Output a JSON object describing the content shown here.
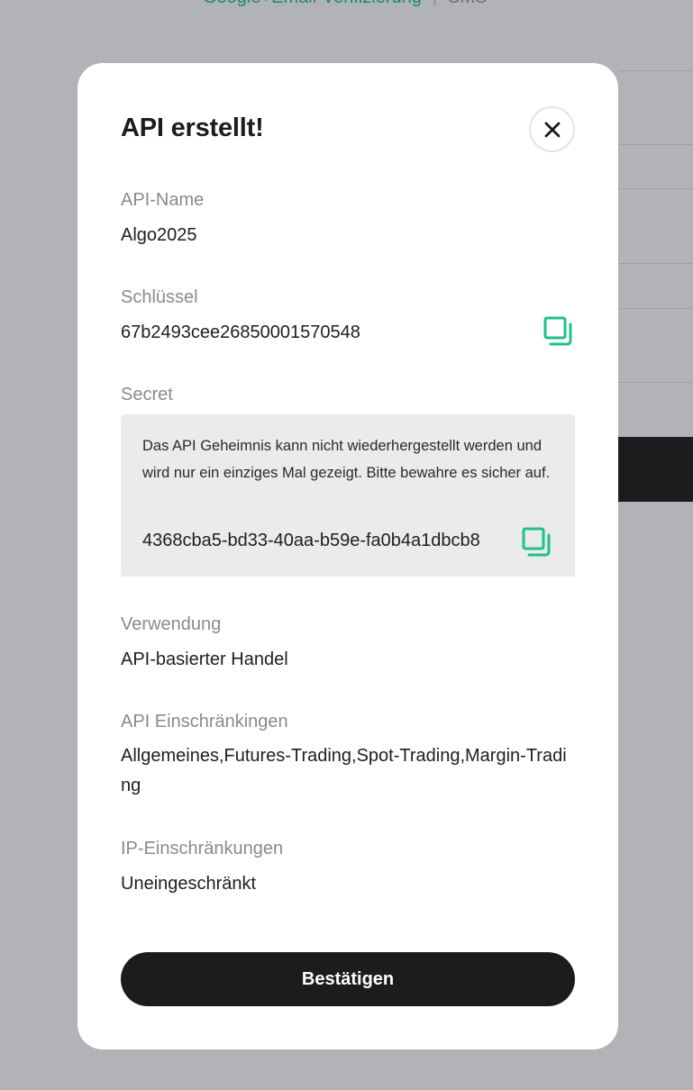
{
  "background": {
    "top_link": "Google+Email-Verifizierung",
    "top_sms": "SMS"
  },
  "modal": {
    "title": "API erstellt!",
    "close_icon": "close-icon",
    "api_name": {
      "label": "API-Name",
      "value": "Algo2025"
    },
    "key": {
      "label": "Schlüssel",
      "value": "67b2493cee26850001570548",
      "copy_icon": "copy-icon"
    },
    "secret": {
      "label": "Secret",
      "note": "Das API Geheimnis kann nicht wiederhergestellt werden und wird nur ein einziges Mal gezeigt. Bitte bewahre es sicher auf.",
      "value": "4368cba5-bd33-40aa-b59e-fa0b4a1dbcb8",
      "copy_icon": "copy-icon"
    },
    "usage": {
      "label": "Verwendung",
      "value": "API-basierter Handel"
    },
    "api_restrictions": {
      "label": "API Einschränkingen",
      "value": "Allgemeines,Futures-Trading,Spot-Trading,Margin-Trading"
    },
    "ip_restrictions": {
      "label": "IP-Einschränkungen",
      "value": "Uneingeschränkt"
    },
    "confirm_label": "Bestätigen"
  },
  "colors": {
    "accent": "#1ec28b",
    "overlay": "#b1b3b6",
    "button": "#1c1c1c"
  }
}
